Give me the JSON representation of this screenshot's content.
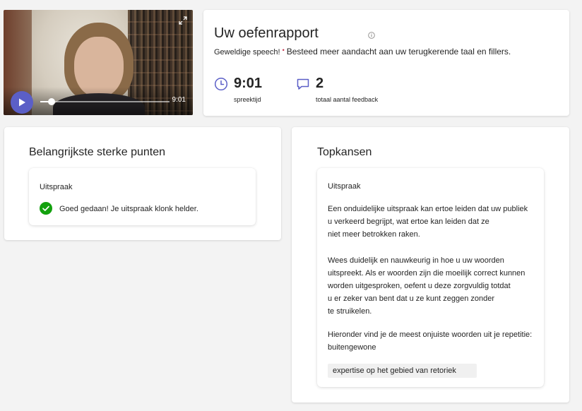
{
  "video": {
    "duration": "9:01",
    "progress": 0.09
  },
  "report": {
    "title": "Uw oefenrapport",
    "subtitle": "Geweldige speech!",
    "separator": "•",
    "message": "Besteed meer aandacht aan uw terugkerende taal en fillers.",
    "stats": [
      {
        "value": "9:01",
        "label": "spreektijd",
        "icon": "clock-icon"
      },
      {
        "value": "2",
        "label": "totaal aantal feedback",
        "icon": "chat-icon"
      }
    ]
  },
  "strengths": {
    "title": "Belangrijkste sterke punten",
    "category": "Uitspraak",
    "message": "Goed gedaan! Je uitspraak klonk helder."
  },
  "opportunities": {
    "title": "Topkansen",
    "category": "Uitspraak",
    "para1": [
      "Een onduidelijke uitspraak kan ertoe leiden dat uw publiek",
      "u verkeerd begrijpt, wat ertoe kan leiden dat ze",
      "niet meer betrokken raken."
    ],
    "para2": [
      "Wees duidelijk en nauwkeurig in hoe u uw woorden",
      "uitspreekt. Als er woorden zijn die moeilijk correct kunnen",
      "worden uitgesproken, oefent u deze zorgvuldig totdat",
      "u er zeker van bent dat u ze kunt zeggen zonder",
      "te struikelen."
    ],
    "para3": [
      "Hieronder vind je de meest onjuiste woorden uit je repetitie:",
      "buitengewone"
    ],
    "chip": "expertise op het gebied van retoriek"
  },
  "colors": {
    "accent": "#5b5fc7",
    "success": "#13a10e"
  }
}
